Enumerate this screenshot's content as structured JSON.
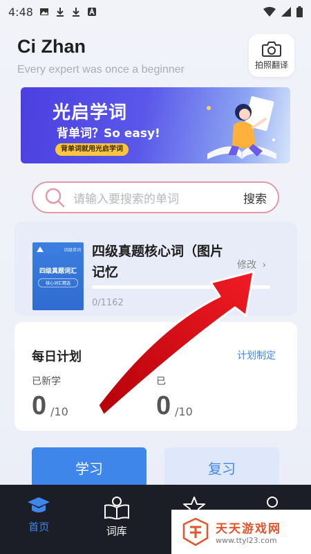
{
  "status_bar": {
    "time": "4:48"
  },
  "header": {
    "title": "Ci Zhan",
    "subtitle": "Every expert was once a beginner",
    "photo_translate_label": "拍照翻译"
  },
  "banner": {
    "title": "光启学词",
    "subtitle": "背单词？So easy!",
    "pill": "背单词就用光启学词"
  },
  "search": {
    "placeholder": "请输入要搜索的单词",
    "button_label": "搜索"
  },
  "current_book": {
    "title": "四级真题核心词（图片记忆",
    "edit_label": "修改",
    "progress_text": "0/1162",
    "progress_fraction": 0,
    "cover_top": "四级单词",
    "cover_title": "四级真题词汇",
    "cover_badge": "核心词汇精选"
  },
  "daily_plan": {
    "title": "每日计划",
    "set_plan_label": "计划制定",
    "new_learned_label": "已新学",
    "new_learned_value": "0",
    "new_learned_total": "/10",
    "second_label": "已",
    "second_value": "0",
    "second_total": "/10"
  },
  "actions": {
    "study_label": "学习",
    "review_label": "复习"
  },
  "tab_bar": {
    "tabs": [
      {
        "label": "首页",
        "icon": "graduation-cap-icon",
        "active": true
      },
      {
        "label": "词库",
        "icon": "book-person-icon",
        "active": false
      },
      {
        "label": "",
        "icon": "star-icon",
        "active": false
      },
      {
        "label": "",
        "icon": "person-icon",
        "active": false
      }
    ]
  },
  "watermark": {
    "text": "天天游戏网",
    "url": "www.ttyl23.com"
  },
  "colors": {
    "accent": "#3f86ea",
    "search_border": "#e29aa8",
    "tab_bar_bg": "#1b1e26",
    "annotation_arrow": "#e0141c"
  }
}
